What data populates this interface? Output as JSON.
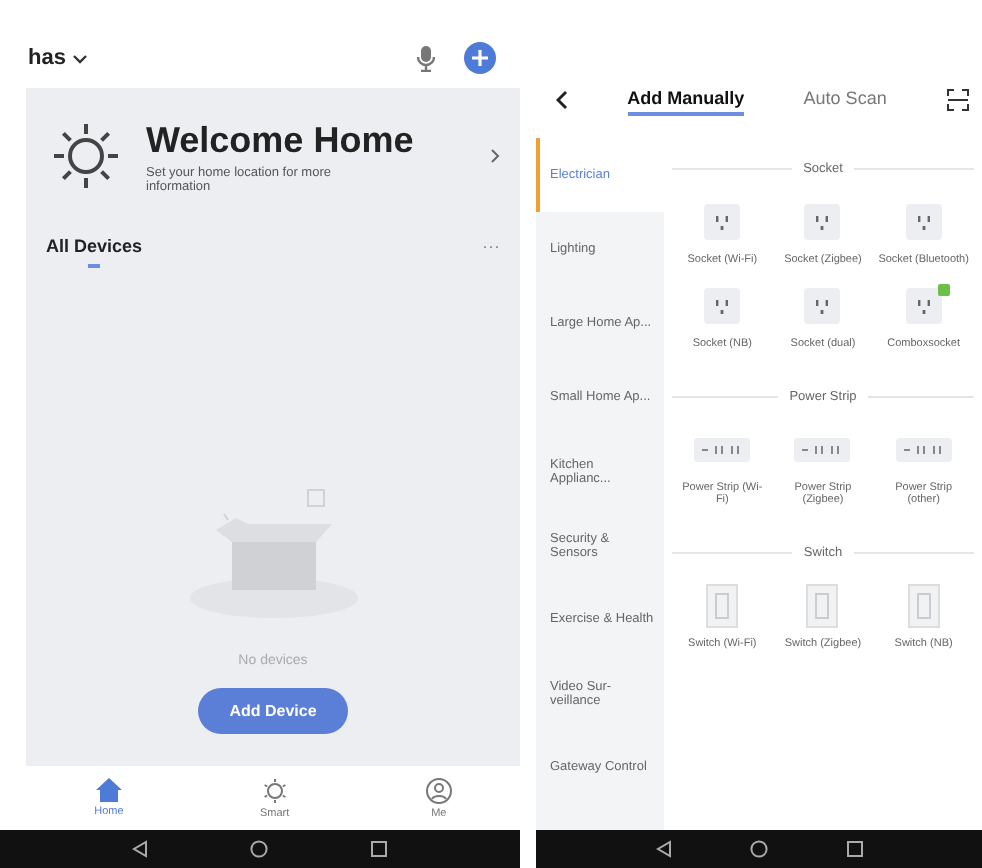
{
  "home": {
    "home_name": "has",
    "welcome_title": "Welcome Home",
    "welcome_subtitle": "Set your home location for more information",
    "section_title": "All Devices",
    "more": "···",
    "empty_text": "No devices",
    "add_button": "Add Device",
    "tabs": [
      {
        "label": "Home",
        "kind": "home",
        "selected": true
      },
      {
        "label": "Smart",
        "kind": "smart",
        "selected": false
      },
      {
        "label": "Me",
        "kind": "me",
        "selected": false
      }
    ]
  },
  "add_device": {
    "tabs": [
      {
        "label": "Add Manually",
        "selected": true
      },
      {
        "label": "Auto Scan",
        "selected": false
      }
    ],
    "categories": [
      {
        "label": "Electrician",
        "selected": true
      },
      {
        "label": "Lighting",
        "selected": false
      },
      {
        "label": "Large Home Ap...",
        "selected": false
      },
      {
        "label": "Small Home Ap...",
        "selected": false
      },
      {
        "label": "Kitchen Applianc...",
        "selected": false
      },
      {
        "label": "Security & Sensors",
        "selected": false
      },
      {
        "label": "Exercise & Health",
        "selected": false
      },
      {
        "label": "Video Sur-veillance",
        "selected": false
      },
      {
        "label": "Gateway Control",
        "selected": false
      }
    ],
    "sections": [
      {
        "title": "Socket",
        "kind": "socket",
        "items": [
          {
            "label": "Socket (Wi-Fi)",
            "badge": false
          },
          {
            "label": "Socket (Zigbee)",
            "badge": false
          },
          {
            "label": "Socket (Bluetooth)",
            "badge": false
          },
          {
            "label": "Socket (NB)",
            "badge": false
          },
          {
            "label": "Socket (dual)",
            "badge": false
          },
          {
            "label": "Comboxsocket",
            "badge": true
          }
        ]
      },
      {
        "title": "Power Strip",
        "kind": "strip",
        "items": [
          {
            "label": "Power Strip (Wi-Fi)",
            "badge": false
          },
          {
            "label": "Power Strip (Zigbee)",
            "badge": false
          },
          {
            "label": "Power Strip (other)",
            "badge": false
          }
        ]
      },
      {
        "title": "Switch",
        "kind": "switch",
        "items": [
          {
            "label": "Switch (Wi-Fi)",
            "badge": false
          },
          {
            "label": "Switch (Zigbee)",
            "badge": false
          },
          {
            "label": "Switch (NB)",
            "badge": false
          }
        ]
      }
    ]
  }
}
